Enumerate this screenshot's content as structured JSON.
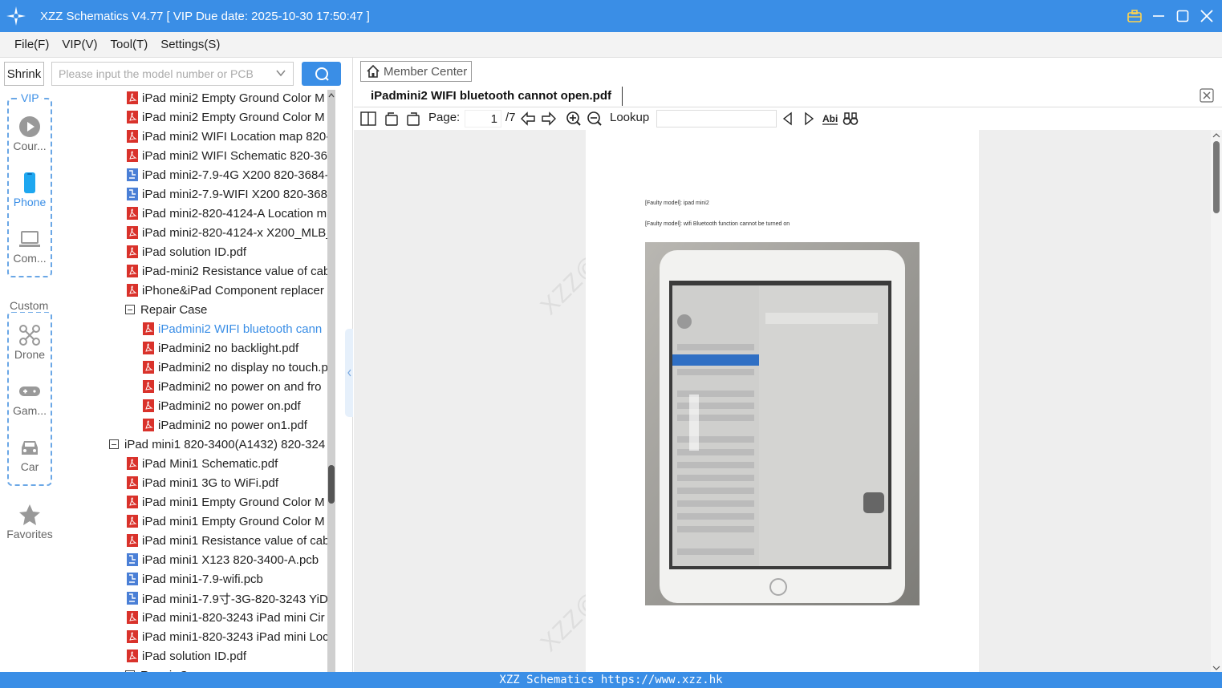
{
  "window": {
    "title": "XZZ Schematics V4.77 [ VIP Due date: 2025-10-30 17:50:47 ]"
  },
  "menu": [
    "File(F)",
    "VIP(V)",
    "Tool(T)",
    "Settings(S)"
  ],
  "search": {
    "shrink_label": "Shrink",
    "placeholder": "Please input the model number or PCB"
  },
  "rail": {
    "vip_label": "VIP",
    "custom_label": "Custom",
    "vip_items": [
      "Cour...",
      "Phone",
      "Com..."
    ],
    "custom_items": [
      "Drone",
      "Gam...",
      "Car"
    ],
    "favorites": "Favorites"
  },
  "tree": [
    {
      "label": "iPad mini2 Empty Ground Color M",
      "type": "pdf"
    },
    {
      "label": "iPad mini2 Empty Ground Color M",
      "type": "pdf"
    },
    {
      "label": "iPad mini2 WIFI Location map 820-",
      "type": "pdf"
    },
    {
      "label": "iPad mini2 WIFI Schematic 820-368",
      "type": "pdf"
    },
    {
      "label": "iPad mini2-7.9-4G X200 820-3684-",
      "type": "pcb"
    },
    {
      "label": "iPad mini2-7.9-WIFI X200 820-3683",
      "type": "pcb"
    },
    {
      "label": "iPad mini2-820-4124-A Location m",
      "type": "pdf"
    },
    {
      "label": "iPad mini2-820-4124-x X200_MLB_",
      "type": "pdf"
    },
    {
      "label": "iPad solution ID.pdf",
      "type": "pdf"
    },
    {
      "label": "iPad-mini2 Resistance value of cab",
      "type": "pdf"
    },
    {
      "label": "iPhone&iPad Component replacer",
      "type": "pdf"
    },
    {
      "label": "Repair Case",
      "type": "folder"
    },
    {
      "label": "iPadmini2 WIFI bluetooth cann",
      "type": "pdf2",
      "active": true
    },
    {
      "label": "iPadmini2 no backlight.pdf",
      "type": "pdf2"
    },
    {
      "label": "iPadmini2 no display no touch.p",
      "type": "pdf2"
    },
    {
      "label": "iPadmini2 no power on and fro",
      "type": "pdf2"
    },
    {
      "label": "iPadmini2 no power on.pdf",
      "type": "pdf2"
    },
    {
      "label": "iPadmini2 no power on1.pdf",
      "type": "pdf2"
    },
    {
      "label": "iPad mini1 820-3400(A1432) 820-324",
      "type": "folder0"
    },
    {
      "label": "iPad Mini1 Schematic.pdf",
      "type": "pdf"
    },
    {
      "label": "iPad mini1 3G to WiFi.pdf",
      "type": "pdf"
    },
    {
      "label": "iPad mini1 Empty Ground Color M",
      "type": "pdf"
    },
    {
      "label": "iPad mini1 Empty Ground Color M",
      "type": "pdf"
    },
    {
      "label": "iPad mini1 Resistance value of cab",
      "type": "pdf"
    },
    {
      "label": "iPad mini1 X123 820-3400-A.pcb",
      "type": "pcb"
    },
    {
      "label": "iPad mini1-7.9-wifi.pcb",
      "type": "pcb"
    },
    {
      "label": "iPad mini1-7.9寸-3G-820-3243 YiD",
      "type": "pcb"
    },
    {
      "label": "iPad mini1-820-3243 iPad mini Cir",
      "type": "pdf"
    },
    {
      "label": "iPad mini1-820-3243 iPad mini Loc",
      "type": "pdf"
    },
    {
      "label": "iPad solution ID.pdf",
      "type": "pdf"
    },
    {
      "label": "Repair Case",
      "type": "folder"
    }
  ],
  "right": {
    "member_center": "Member Center",
    "doc_title": "iPadmini2 WIFI bluetooth cannot open.pdf",
    "page_label": "Page:",
    "page_value": "1",
    "page_total": "/7",
    "lookup_label": "Lookup"
  },
  "pdf": {
    "line1": "[Faulty model]: ipad mini2",
    "line2": "[Faulty model]: wifi Bluetooth function cannot be turned on",
    "watermark": "XZZ@XZZHK"
  },
  "status": "XZZ Schematics https://www.xzz.hk",
  "colors": {
    "accent": "#3a8ee6",
    "pdf_red": "#d9322b",
    "pcb_blue": "#4a7fd6"
  }
}
